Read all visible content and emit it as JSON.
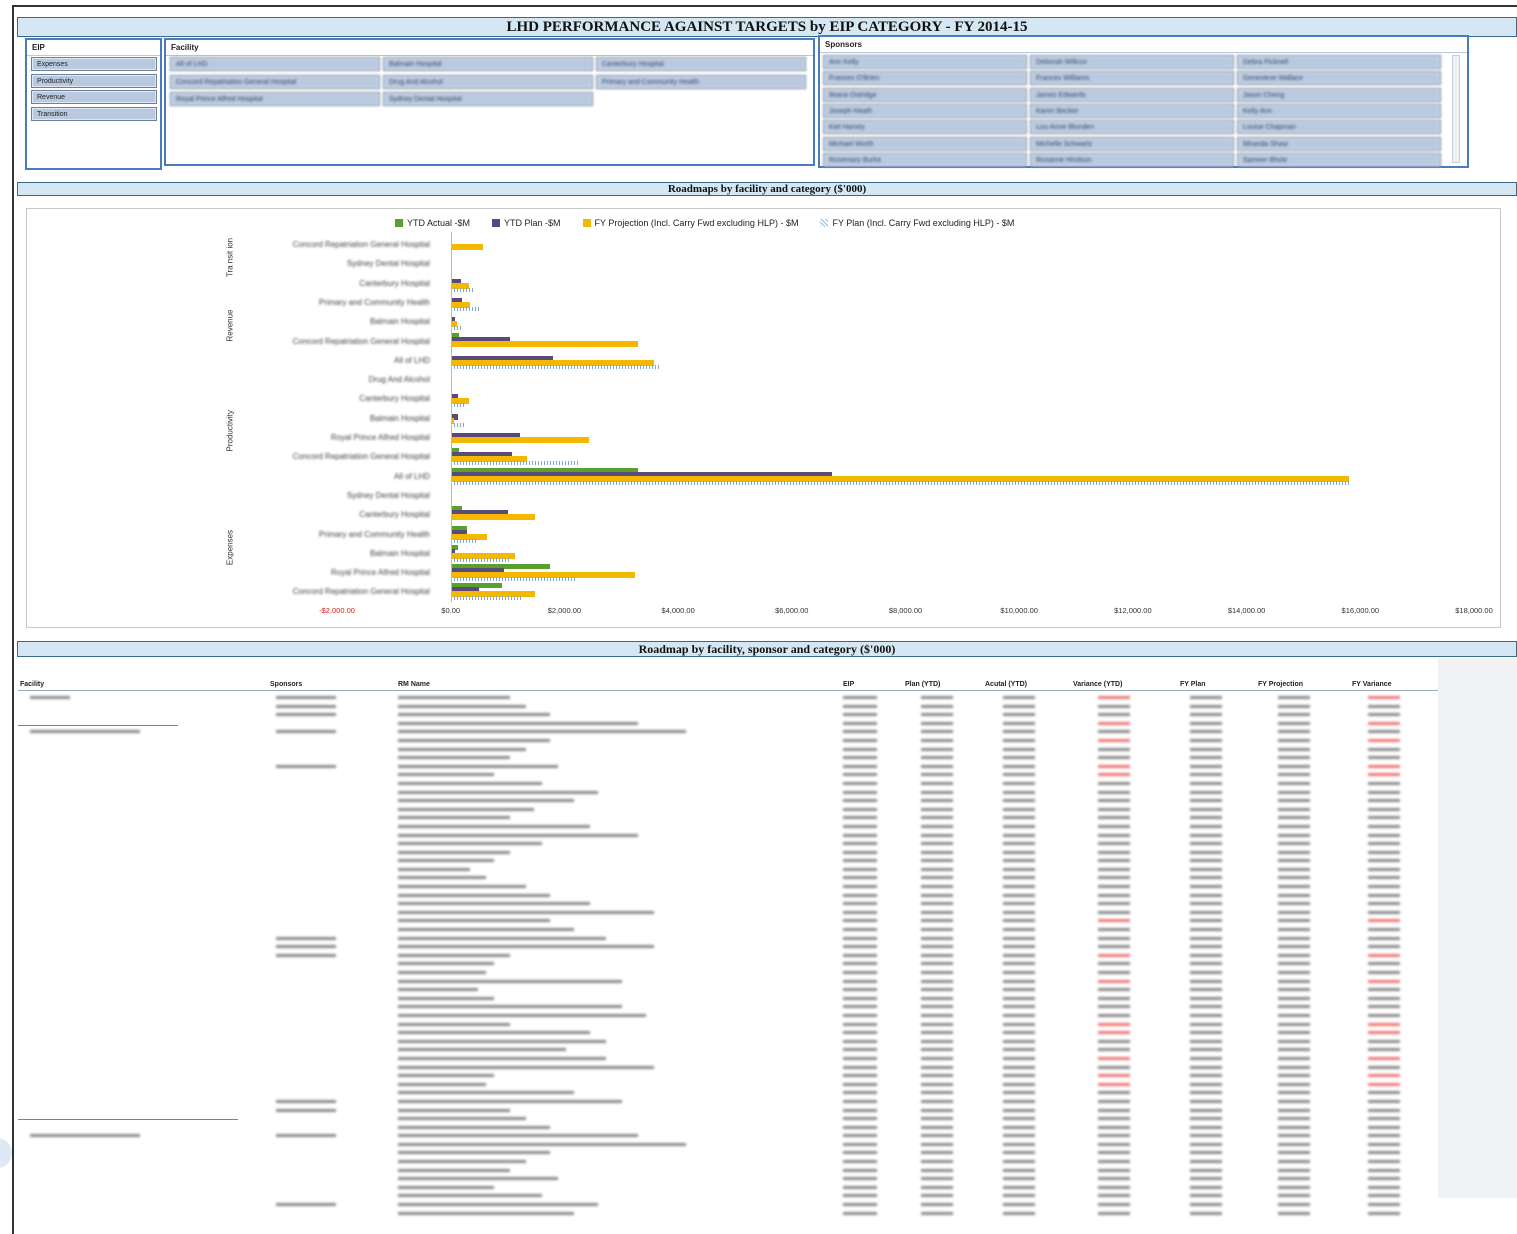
{
  "title": "LHD PERFORMANCE AGAINST TARGETS by EIP CATEGORY - FY 2014-15",
  "slicers": {
    "eip": {
      "header": "EIP",
      "items": [
        "Expenses",
        "Productivity",
        "Revenue",
        "Transition"
      ]
    },
    "facility": {
      "header": "Facility",
      "items": [
        "All of LHD",
        "Balmain Hospital",
        "Canterbury Hospital",
        "Concord Repatriation General Hospital",
        "Drug And Alcohol",
        "Primary and Community Health",
        "Royal Prince Alfred Hospital",
        "Sydney Dental Hospital"
      ]
    },
    "sponsors": {
      "header": "Sponsors",
      "items": [
        "Ann Kelly",
        "Deborah Willcox",
        "Debra Picknell",
        "Frances O'Brien",
        "Frances Williams",
        "Genevieve Wallace",
        "Ileana Ostridge",
        "James Edwards",
        "Jason Cheng",
        "Joseph Heath",
        "Karen Becker",
        "Kelly Ann",
        "Kiel Harvey",
        "Lou-Anne Blunden",
        "Louise Chapman",
        "Michael Worth",
        "Michelle Schwartz",
        "Miranda Shaw",
        "Rosemary Burke",
        "Roxanne Hindson",
        "Sameer Bhole"
      ]
    }
  },
  "section_chart_title": "Roadmaps by facility and category ($'000)",
  "section_table_title": "Roadmap by facility, sponsor and category ($'000)",
  "chart_data": {
    "type": "bar",
    "orientation": "horizontal",
    "title": "",
    "legend_position": "top",
    "xlim": [
      -2000,
      18000
    ],
    "x_ticks": [
      "-$2,000.00",
      "$0.00",
      "$2,000.00",
      "$4,000.00",
      "$6,000.00",
      "$8,000.00",
      "$10,000.00",
      "$12,000.00",
      "$14,000.00",
      "$16,000.00",
      "$18,000.00"
    ],
    "series": [
      {
        "name": "YTD Actual -$M",
        "color": "#5aa02c"
      },
      {
        "name": "YTD Plan -$M",
        "color": "#5a4a7a"
      },
      {
        "name": "FY Projection (Incl. Carry Fwd excluding HLP) - $M",
        "color": "#f5b800"
      },
      {
        "name": "FY Plan (Incl. Carry Fwd excluding HLP) - $M",
        "color": "#9bbcd9",
        "pattern": "dotted"
      }
    ],
    "groups": [
      {
        "category": "Tra nsit ion",
        "rows": [
          {
            "label": "Concord Repatriation General Hospital",
            "values": [
              0,
              0,
              560,
              0
            ]
          },
          {
            "label": "Sydney Dental Hospital",
            "values": [
              0,
              0,
              20,
              0
            ]
          }
        ]
      },
      {
        "category": "Revenue",
        "rows": [
          {
            "label": "Canterbury Hospital",
            "values": [
              0,
              180,
              330,
              420
            ]
          },
          {
            "label": "Primary and Community Health",
            "values": [
              0,
              200,
              340,
              500
            ]
          },
          {
            "label": "Balmain Hospital",
            "values": [
              0,
              80,
              110,
              200
            ]
          },
          {
            "label": "Concord Repatriation General Hospital",
            "values": [
              150,
              1050,
              3300,
              0
            ]
          },
          {
            "label": "All of LHD",
            "values": [
              0,
              1800,
              3580,
              3700
            ]
          }
        ]
      },
      {
        "category": "Productivity",
        "rows": [
          {
            "label": "Drug And Alcohol",
            "values": [
              0,
              0,
              0,
              0
            ]
          },
          {
            "label": "Canterbury Hospital",
            "values": [
              0,
              130,
              320,
              250
            ]
          },
          {
            "label": "Balmain Hospital",
            "values": [
              0,
              130,
              50,
              250
            ]
          },
          {
            "label": "Royal Prince Alfred Hospital",
            "values": [
              0,
              1220,
              2440,
              0
            ]
          },
          {
            "label": "Concord Repatriation General Hospital",
            "values": [
              150,
              1080,
              1350,
              2280
            ]
          },
          {
            "label": "All of LHD",
            "values": [
              3300,
              6700,
              15800,
              15800
            ]
          }
        ]
      },
      {
        "category": "Expenses",
        "rows": [
          {
            "label": "Sydney Dental Hospital",
            "values": [
              0,
              0,
              0,
              0
            ]
          },
          {
            "label": "Canterbury Hospital",
            "values": [
              200,
              1000,
              1480,
              0
            ]
          },
          {
            "label": "Primary and Community Health",
            "values": [
              290,
              290,
              640,
              480
            ]
          },
          {
            "label": "Balmain Hospital",
            "values": [
              120,
              80,
              1130,
              1050
            ]
          },
          {
            "label": "Royal Prince Alfred Hospital",
            "values": [
              1750,
              930,
              3250,
              2200
            ]
          },
          {
            "label": "Concord Repatriation General Hospital",
            "values": [
              900,
              500,
              1490,
              1280
            ]
          }
        ]
      }
    ]
  },
  "table": {
    "headers": [
      "Facility",
      "Sponsors",
      "RM Name",
      "EIP",
      "Plan (YTD)",
      "Acutal (YTD)",
      "Variance (YTD)",
      "FY Plan",
      "FY Projection",
      "FY Variance"
    ]
  }
}
